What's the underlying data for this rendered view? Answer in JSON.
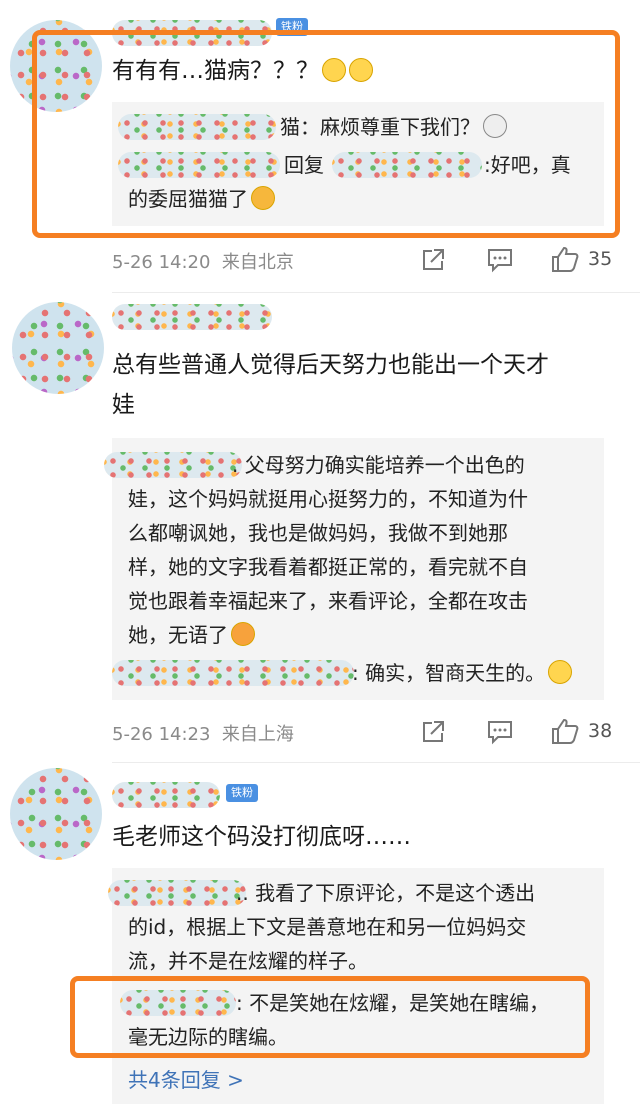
{
  "comments": [
    {
      "badge": "铁粉",
      "text": "有有有…猫病？？？",
      "replies": [
        {
          "text": "猫：麻烦尊重下我们？"
        },
        {
          "text_a": "回复",
          "text_b": ":好吧，真",
          "text_c": "的委屈猫猫了"
        }
      ],
      "time": "5-26 14:20",
      "location": "来自北京",
      "likes": "35"
    },
    {
      "text_line1": "总有些普通人觉得后天努力也能出一个天才",
      "text_line2": "娃",
      "replies": [
        {
          "lines": [
            ". 父母努力确实能培养一个出色的",
            "娃，这个妈妈就挺用心挺努力的，不知道为什",
            "么都嘲讽她，我也是做妈妈，我做不到她那",
            "样，她的文字我看着都挺正常的，看完就不自",
            "觉也跟着幸福起来了，来看评论，全都在攻击",
            "她，无语了"
          ]
        },
        {
          "text": ": 确实，智商天生的。"
        }
      ],
      "time": "5-26 14:23",
      "location": "来自上海",
      "likes": "38"
    },
    {
      "badge": "铁粉",
      "text": "毛老师这个码没打彻底呀……",
      "replies": [
        {
          "lines": ".. 我看了下原评论，不是这个透出|的id，根据上下文是善意地在和另一位妈妈交|流，并不是在炫耀的样子。"
        },
        {
          "line1": ": 不是笑她在炫耀，是笑她在瞎编，",
          "line2": "毫无边际的瞎编。"
        }
      ],
      "more": "共4条回复 >"
    }
  ]
}
